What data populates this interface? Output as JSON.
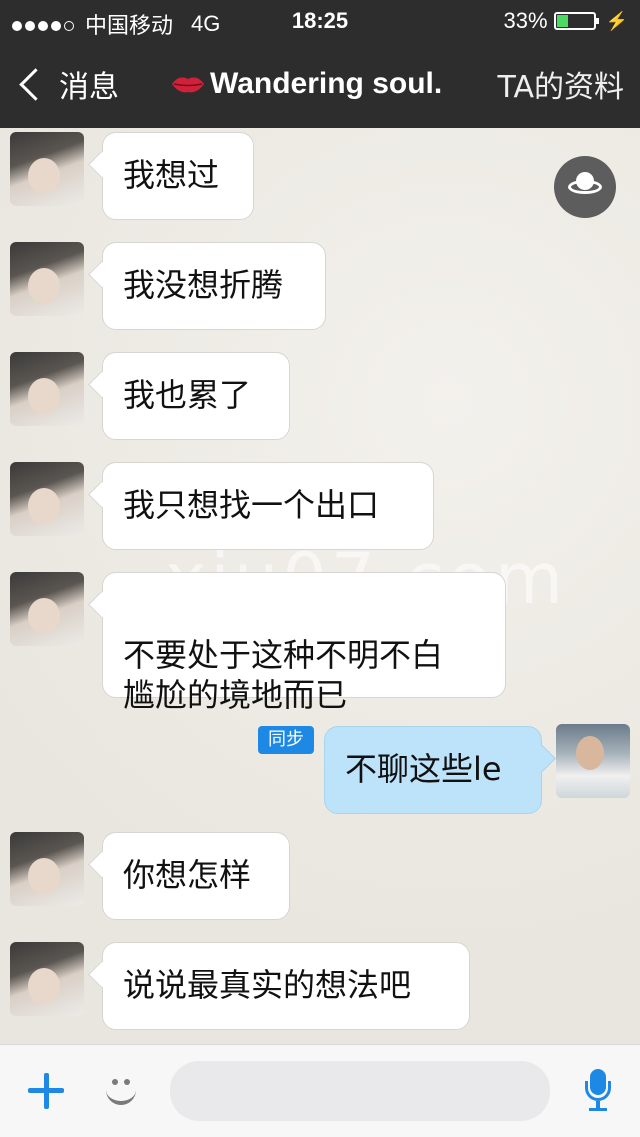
{
  "status_bar": {
    "carrier": "中国移动",
    "network": "4G",
    "time": "18:25",
    "battery_percent": "33%",
    "battery_level": 0.33,
    "signal_bars": 4
  },
  "nav": {
    "back_label": "消息",
    "title": "Wandering soul.",
    "right_label": "TA的资料"
  },
  "messages": [
    {
      "side": "left",
      "text": "我想过"
    },
    {
      "side": "left",
      "text": "我没想折腾"
    },
    {
      "side": "left",
      "text": "我也累了"
    },
    {
      "side": "left",
      "text": "我只想找一个出口"
    },
    {
      "side": "left",
      "text": "不要处于这种不明不白\n尴尬的境地而已"
    },
    {
      "side": "right",
      "text": "不聊这些le",
      "badge": "同步"
    },
    {
      "side": "left",
      "text": "你想怎样"
    },
    {
      "side": "left",
      "text": "说说最真实的想法吧"
    }
  ],
  "watermark": "xiu07.com",
  "input": {
    "placeholder": ""
  },
  "icons": {
    "back": "chevron-left-icon",
    "title_emblem": "lips-icon",
    "float": "ufo-icon",
    "plus": "plus-icon",
    "emoji": "smile-icon",
    "voice": "microphone-icon"
  },
  "colors": {
    "nav_bg": "#2d2d2d",
    "my_bubble": "#bde3fb",
    "their_bubble": "#ffffff",
    "accent": "#1e88e5",
    "battery": "#4cd964"
  }
}
